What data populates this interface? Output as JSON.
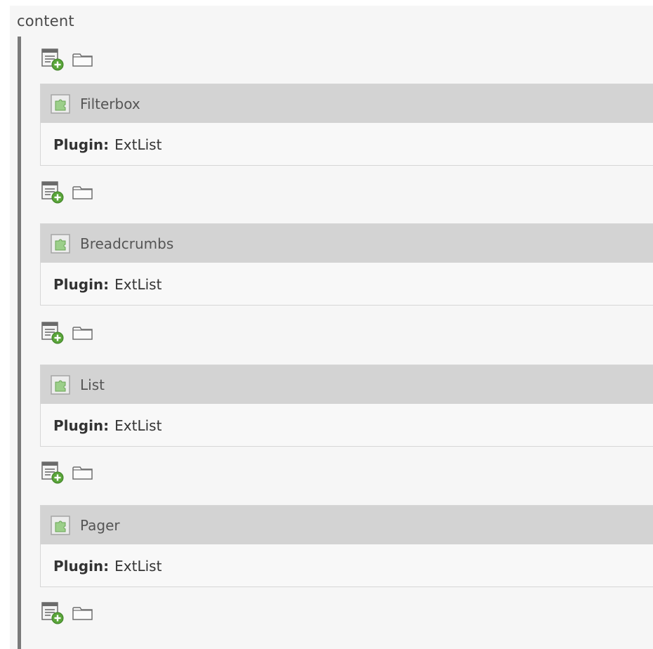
{
  "section": {
    "title": "content"
  },
  "toolbar": {
    "new_icon": "new-content-element-icon",
    "paste_icon": "folder-icon"
  },
  "elements": [
    {
      "title": "Filterbox",
      "plugin_label": "Plugin:",
      "plugin_value": "ExtList",
      "icon": "plugin-puzzle-icon"
    },
    {
      "title": "Breadcrumbs",
      "plugin_label": "Plugin:",
      "plugin_value": "ExtList",
      "icon": "plugin-puzzle-icon"
    },
    {
      "title": "List",
      "plugin_label": "Plugin:",
      "plugin_value": "ExtList",
      "icon": "plugin-puzzle-icon"
    },
    {
      "title": "Pager",
      "plugin_label": "Plugin:",
      "plugin_value": "ExtList",
      "icon": "plugin-puzzle-icon"
    }
  ],
  "colors": {
    "header_bg": "#d3d3d3",
    "panel_bg": "#f6f6f6",
    "column_bar": "#7a7a7a",
    "plus_green": "#5aa53a"
  }
}
